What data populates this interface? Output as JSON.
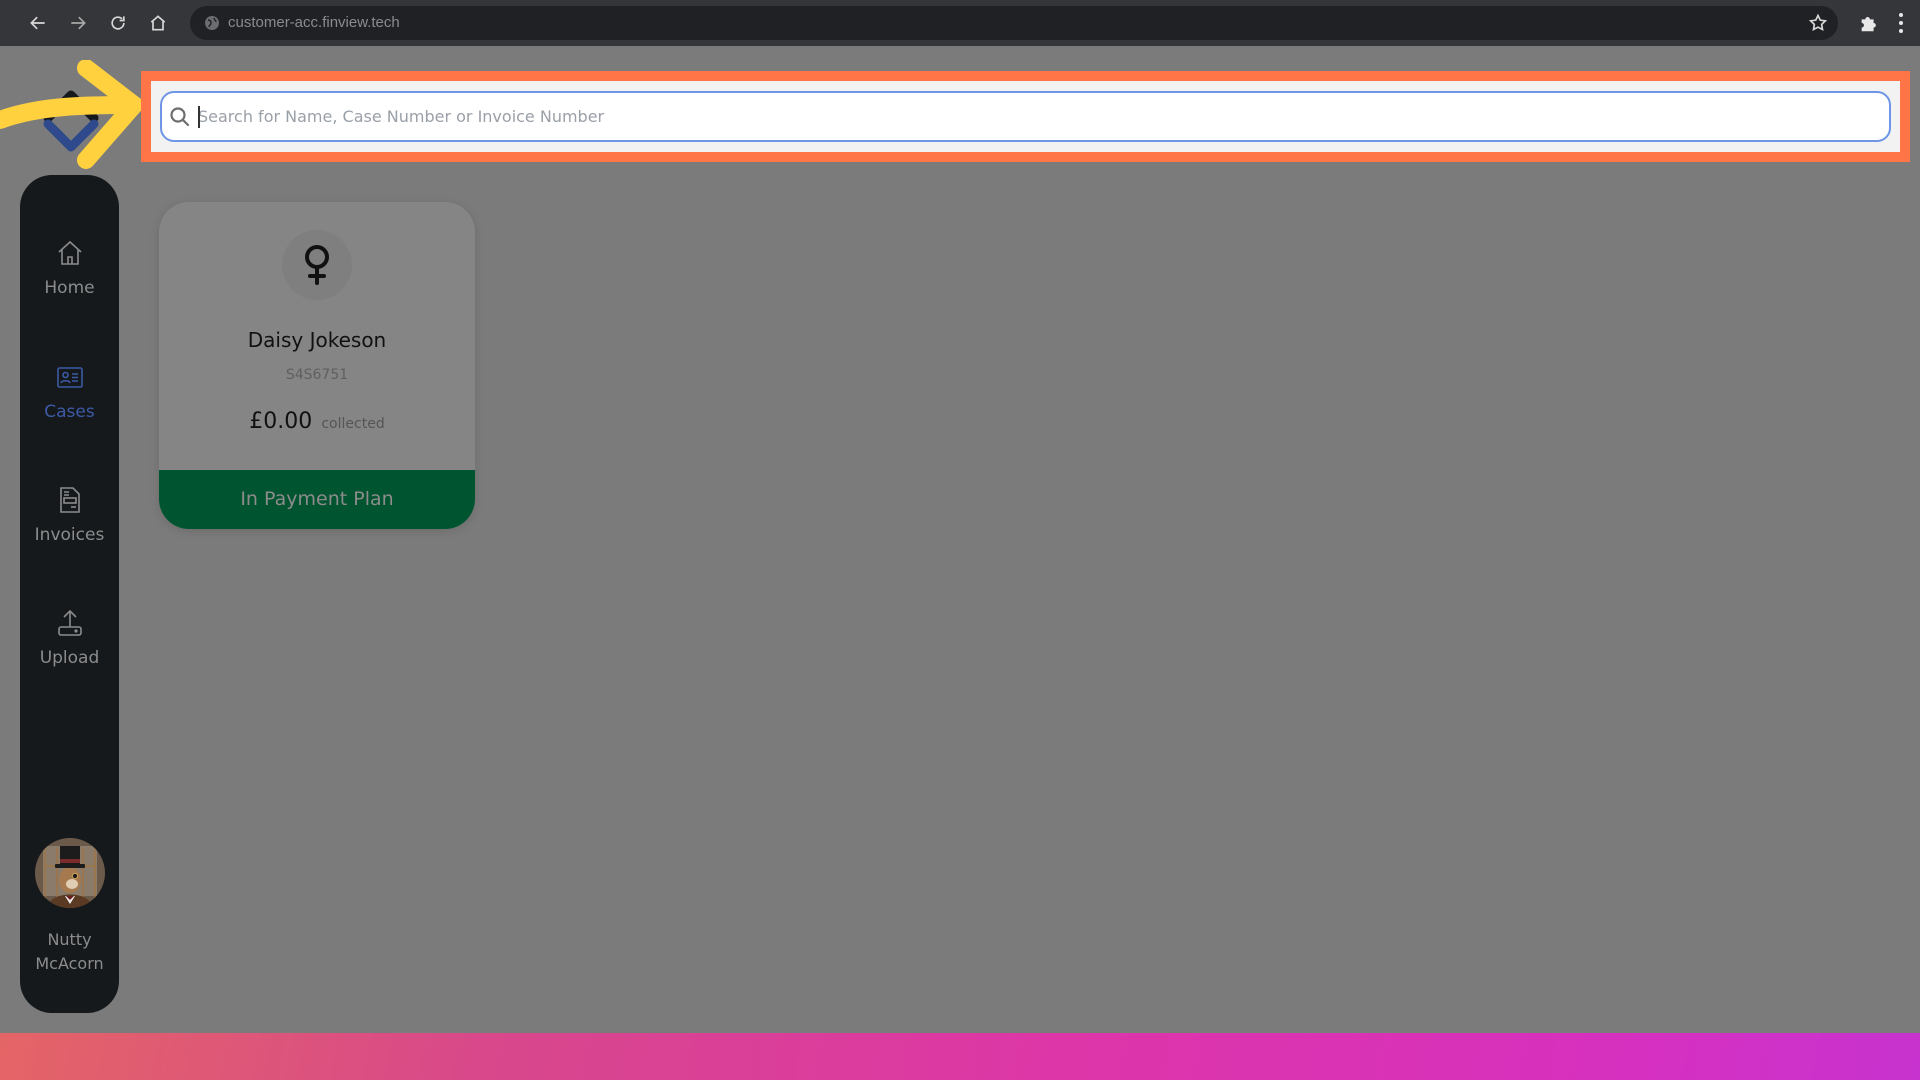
{
  "browser": {
    "url": "customer-acc.finview.tech",
    "icons": [
      "back-arrow-icon",
      "forward-arrow-icon",
      "reload-icon",
      "home-icon",
      "site-info-globe-icon",
      "bookmark-star-icon",
      "extensions-puzzle-icon",
      "more-menu-kebab-icon"
    ]
  },
  "search": {
    "placeholder": "Search for Name, Case Number or Invoice Number",
    "value": "",
    "highlight_color": "#ff7548"
  },
  "sidebar": {
    "items": [
      {
        "label": "Home",
        "icon": "home-icon",
        "active": false
      },
      {
        "label": "Cases",
        "icon": "id-card-icon",
        "active": true
      },
      {
        "label": "Invoices",
        "icon": "invoice-document-icon",
        "active": false
      },
      {
        "label": "Upload",
        "icon": "upload-tray-icon",
        "active": false
      }
    ],
    "profile": {
      "name_line1": "Nutty",
      "name_line2": "McAcorn"
    },
    "active_color": "#3c5aa6"
  },
  "cases": [
    {
      "name": "Daisy Jokeson",
      "case_number": "S4S6751",
      "amount": "£0.00",
      "amount_suffix": "collected",
      "status": "In Payment Plan",
      "status_color": "#00542f",
      "gender_icon": "female-symbol-icon"
    }
  ],
  "annotation": {
    "arrow_color": "#ffd13f"
  }
}
